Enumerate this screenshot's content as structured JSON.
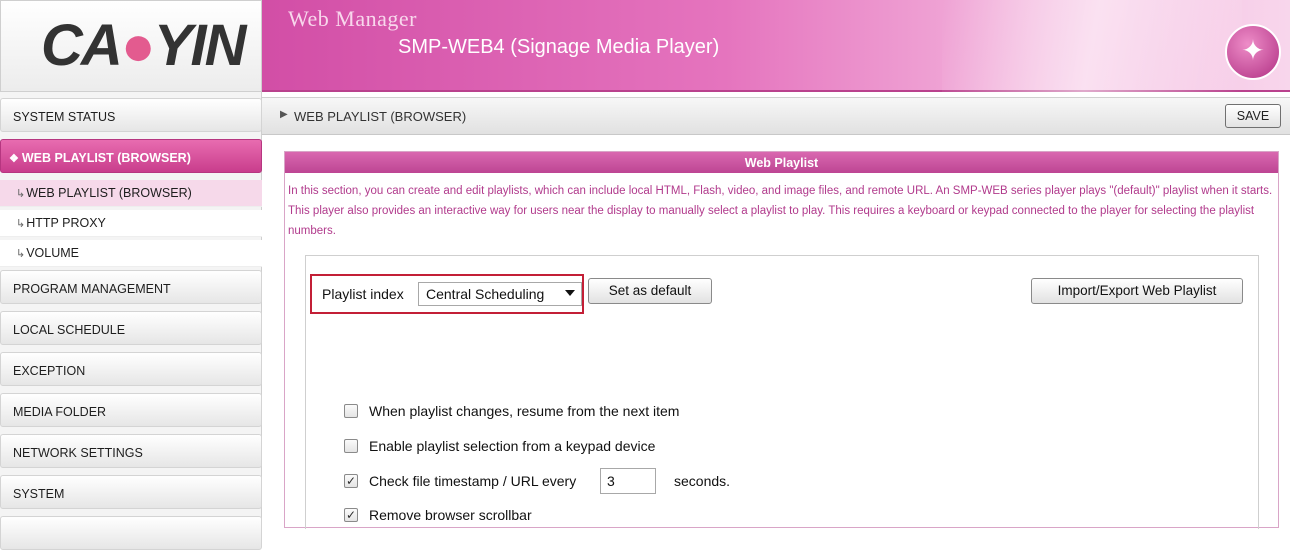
{
  "brand": {
    "logo_text_1": "CA",
    "logo_text_2": "YIN"
  },
  "header": {
    "app_title": "Web Manager",
    "device_title": "SMP-WEB4 (Signage Media Player)",
    "accent_color": "#d24ea6",
    "icon": "magic-wand-icon"
  },
  "sidebar": {
    "items": [
      {
        "label": "SYSTEM STATUS",
        "active": false
      },
      {
        "label": "WEB PLAYLIST (BROWSER)",
        "active": true
      },
      {
        "label": "PROGRAM MANAGEMENT",
        "active": false
      },
      {
        "label": "LOCAL SCHEDULE",
        "active": false
      },
      {
        "label": "EXCEPTION",
        "active": false
      },
      {
        "label": "MEDIA FOLDER",
        "active": false
      },
      {
        "label": "NETWORK SETTINGS",
        "active": false
      },
      {
        "label": "SYSTEM",
        "active": false
      }
    ],
    "sub_items": [
      {
        "label": "WEB PLAYLIST (BROWSER)",
        "current": true
      },
      {
        "label": "HTTP PROXY",
        "current": false
      },
      {
        "label": "VOLUME",
        "current": false
      }
    ],
    "active_marker_glyph": "❖",
    "sub_arrow_glyph": "↳"
  },
  "page": {
    "breadcrumb": "WEB PLAYLIST (BROWSER)",
    "save_label": "SAVE"
  },
  "panel": {
    "title": "Web Playlist",
    "description": "In this section, you can create and edit playlists, which can include local HTML, Flash, video, and image files, and remote URL. An SMP-WEB series player plays \"(default)\" playlist when it starts. This player also provides an interactive way for users near the display to manually select a playlist to play. This requires a keyboard or keypad connected to the player for selecting the playlist numbers.",
    "playlist_index_label": "Playlist index",
    "playlist_index_value": "Central Scheduling",
    "set_default_label": "Set as default",
    "import_export_label": "Import/Export Web Playlist",
    "options": [
      {
        "label": "When playlist changes, resume from the next item",
        "checked": false
      },
      {
        "label": "Enable playlist selection from a keypad device",
        "checked": false
      },
      {
        "label": "Check file timestamp / URL every",
        "checked": true
      },
      {
        "label": "Remove browser scrollbar",
        "checked": true
      }
    ],
    "check_interval_value": "3",
    "check_interval_unit": "seconds."
  }
}
